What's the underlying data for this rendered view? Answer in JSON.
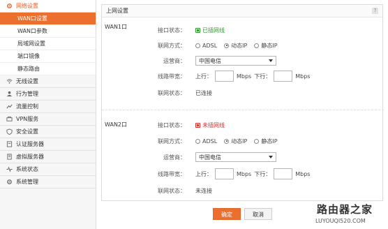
{
  "sidebar": {
    "groups": [
      {
        "label": "网络设置",
        "icon": "gear-icon"
      },
      {
        "label": "无线设置",
        "icon": "wifi-icon"
      },
      {
        "label": "行为管理",
        "icon": "user-icon"
      },
      {
        "label": "流量控制",
        "icon": "traffic-icon"
      },
      {
        "label": "VPN服务",
        "icon": "vpn-icon"
      },
      {
        "label": "安全设置",
        "icon": "shield-icon"
      },
      {
        "label": "认证服务器",
        "icon": "server-icon"
      },
      {
        "label": "虚拟服务器",
        "icon": "virtual-server-icon"
      },
      {
        "label": "系统状态",
        "icon": "status-icon"
      },
      {
        "label": "系统管理",
        "icon": "settings-icon"
      }
    ],
    "subitems": [
      "WAN口设置",
      "WAN口参数",
      "局域网设置",
      "端口镜像",
      "静态路由"
    ]
  },
  "main": {
    "title": "上网设置",
    "help": "?",
    "wan1": {
      "label": "WAN1口",
      "port_status_label": "接口状态：",
      "port_status": "已插网线",
      "conn_type_label": "联网方式：",
      "conn_options": [
        "ADSL",
        "动态IP",
        "静态IP"
      ],
      "conn_selected": "动态IP",
      "isp_label": "运营商：",
      "isp_value": "中国电信",
      "bandwidth_label": "线路带宽：",
      "up_label": "上行：",
      "up_unit": "Mbps",
      "down_label": "下行：",
      "down_unit": "Mbps",
      "net_status_label": "联网状态：",
      "net_status": "已连接"
    },
    "wan2": {
      "label": "WAN2口",
      "port_status_label": "接口状态：",
      "port_status": "未插网线",
      "conn_type_label": "联网方式：",
      "conn_options": [
        "ADSL",
        "动态IP",
        "静态IP"
      ],
      "conn_selected": "动态IP",
      "isp_label": "运营商：",
      "isp_value": "中国电信",
      "bandwidth_label": "线路带宽：",
      "up_label": "上行：",
      "up_unit": "Mbps",
      "down_label": "下行：",
      "down_unit": "Mbps",
      "net_status_label": "联网状态：",
      "net_status": "未连接"
    }
  },
  "buttons": {
    "ok": "确定",
    "cancel": "取消"
  },
  "watermark": {
    "title": "路由器之家",
    "url": "LUYOUQI520.COM"
  },
  "colors": {
    "accent": "#ed6f2d",
    "ok_green": "#2e9a2e",
    "warn_red": "#d8302a"
  }
}
